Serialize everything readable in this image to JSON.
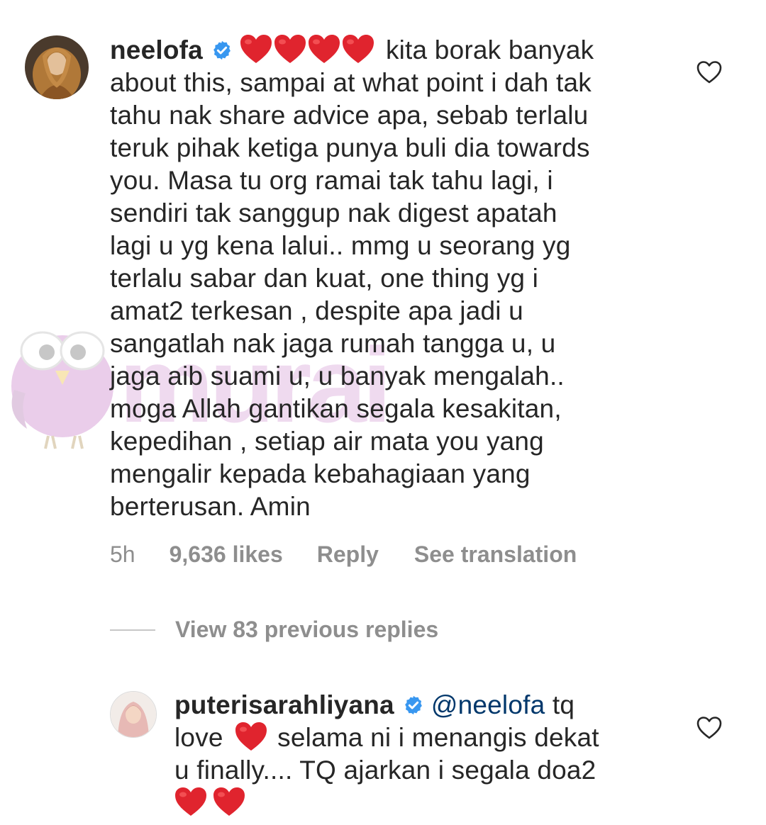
{
  "comment_main": {
    "username": "neelofa",
    "verified": true,
    "emoji_hearts": 4,
    "lines": [
      "kita borak banyak",
      "about this, sampai at what point i dah tak",
      "tahu nak share advice apa, sebab terlalu",
      "teruk pihak ketiga punya buli dia towards",
      "you. Masa tu org ramai tak tahu lagi, i",
      "sendiri tak sanggup nak digest apatah",
      "lagi u yg kena lalui.. mmg u seorang yg",
      "terlalu sabar dan kuat, one thing yg i",
      "amat2 terkesan , despite apa jadi u",
      "sangatlah nak jaga rumah tangga u, u",
      "jaga aib suami u, u banyak mengalah..",
      "moga Allah gantikan segala kesakitan,",
      "kepedihan , setiap  air mata you yang",
      "mengalir kepada kebahagiaan yang",
      "berterusan. Amin"
    ],
    "time": "5h",
    "likes": "9,636 likes",
    "reply_label": "Reply",
    "translate_label": "See translation"
  },
  "view_replies": {
    "label": "View 83 previous replies"
  },
  "comment_reply": {
    "username": "puterisarahliyana",
    "verified": true,
    "mention": "@neelofa",
    "line1_tail": "tq",
    "line2_head": "love",
    "line2_tail": "selama ni i menangis dekat",
    "line3": "u finally.... TQ ajarkan i segala doa2",
    "emoji_hearts_end": 2
  },
  "watermark": {
    "text": "murai"
  },
  "colors": {
    "text": "#262626",
    "meta": "#8e8e8e",
    "mention": "#00376b",
    "verified": "#3897f0",
    "heart": "#e0242e",
    "watermark_pink": "#e6b8e6"
  },
  "icons": {
    "verified": "verified-badge-icon",
    "heart_emoji": "red-heart-emoji",
    "like": "heart-outline-icon"
  }
}
